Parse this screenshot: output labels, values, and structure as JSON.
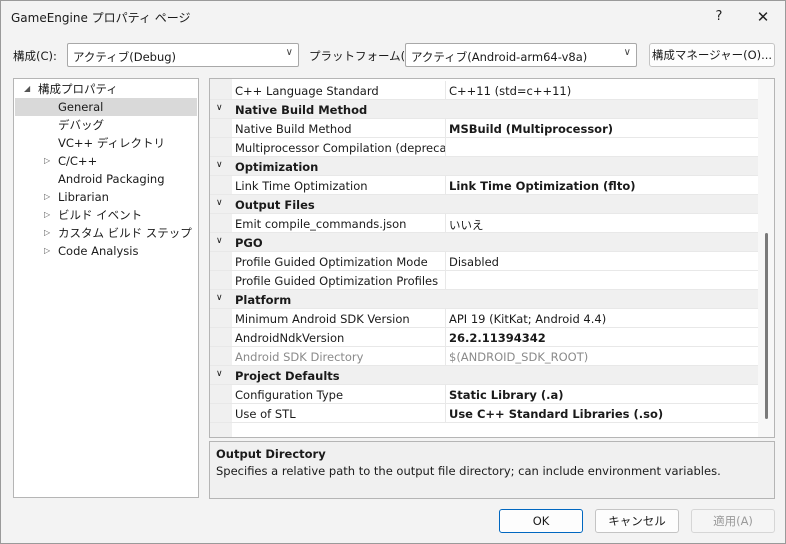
{
  "window": {
    "title": "GameEngine プロパティ ページ",
    "help": "?",
    "close": "✕"
  },
  "config": {
    "label": "構成(C):",
    "value": "アクティブ(Debug)",
    "platform_label": "プラットフォーム(P):",
    "platform_value": "アクティブ(Android-arm64-v8a)",
    "manager_button": "構成マネージャー(O)..."
  },
  "tree": {
    "root": "構成プロパティ",
    "items": [
      {
        "label": "General",
        "expandable": false,
        "selected": true
      },
      {
        "label": "デバッグ",
        "expandable": false
      },
      {
        "label": "VC++ ディレクトリ",
        "expandable": false
      },
      {
        "label": "C/C++",
        "expandable": true
      },
      {
        "label": "Android Packaging",
        "expandable": false
      },
      {
        "label": "Librarian",
        "expandable": true
      },
      {
        "label": "ビルド イベント",
        "expandable": true
      },
      {
        "label": "カスタム ビルド ステップ",
        "expandable": true
      },
      {
        "label": "Code Analysis",
        "expandable": true
      }
    ]
  },
  "grid": {
    "rows": [
      {
        "type": "prop",
        "name": "C++ Language Standard",
        "value": "C++11 (std=c++11)",
        "style": ""
      },
      {
        "type": "cat",
        "name": "Native Build Method"
      },
      {
        "type": "prop",
        "name": "Native Build Method",
        "value": "MSBuild (Multiprocessor)",
        "style": "bold"
      },
      {
        "type": "prop",
        "name": "Multiprocessor Compilation (deprecated",
        "value": "",
        "style": ""
      },
      {
        "type": "cat",
        "name": "Optimization"
      },
      {
        "type": "prop",
        "name": "Link Time Optimization",
        "value": "Link Time Optimization (flto)",
        "style": "bold"
      },
      {
        "type": "cat",
        "name": "Output Files"
      },
      {
        "type": "prop",
        "name": "Emit compile_commands.json",
        "value": "いいえ",
        "style": ""
      },
      {
        "type": "cat",
        "name": "PGO"
      },
      {
        "type": "prop",
        "name": "Profile Guided Optimization Mode",
        "value": "Disabled",
        "style": ""
      },
      {
        "type": "prop",
        "name": "Profile Guided Optimization Profiles",
        "value": "",
        "style": ""
      },
      {
        "type": "cat",
        "name": "Platform"
      },
      {
        "type": "prop",
        "name": "Minimum Android SDK Version",
        "value": "API 19 (KitKat; Android 4.4)",
        "style": ""
      },
      {
        "type": "prop",
        "name": "AndroidNdkVersion",
        "value": "26.2.11394342",
        "style": "bold"
      },
      {
        "type": "prop",
        "name": "Android SDK Directory",
        "value": "$(ANDROID_SDK_ROOT)",
        "style": "gray"
      },
      {
        "type": "cat",
        "name": "Project Defaults"
      },
      {
        "type": "prop",
        "name": "Configuration Type",
        "value": "Static Library (.a)",
        "style": "bold"
      },
      {
        "type": "prop",
        "name": "Use of STL",
        "value": "Use C++ Standard Libraries (.so)",
        "style": "bold"
      }
    ]
  },
  "description": {
    "title": "Output Directory",
    "text": "Specifies a relative path to the output file directory; can include environment variables."
  },
  "buttons": {
    "ok": "OK",
    "cancel": "キャンセル",
    "apply": "適用(A)"
  },
  "icons": {
    "expand_open": "◢",
    "expand_closed": "▷",
    "category_caret": "∨",
    "dropdown": "∨"
  }
}
